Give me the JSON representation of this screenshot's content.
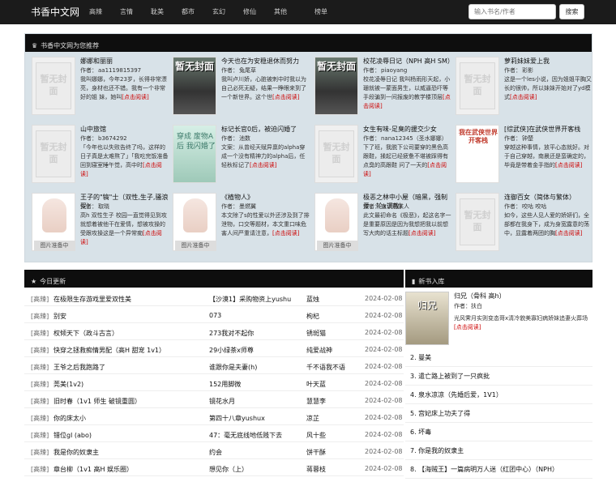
{
  "nav": {
    "brand": "书香中文网",
    "links": [
      "高辣",
      "言情",
      "耽美",
      "都市",
      "玄幻",
      "修仙",
      "其他"
    ],
    "rank": "榜单",
    "search_placeholder": "输入书名/作者",
    "search_button": "搜索"
  },
  "recommend": {
    "title": "书香中文网为您推荐",
    "read_link": "[点击阅读]",
    "placeholder_text": "暂无封面",
    "loading_text": "图片准备中",
    "items": [
      {
        "title": "娜娜和丽丽",
        "author": "aa1119815397",
        "desc": "我叫娜娜，今年23岁，长得非常漂亮，身材也还不错。我有一个非常好的姐 妹，她叫",
        "cover": "placeholder"
      },
      {
        "title": "今天也在为安稳退休而努力",
        "author": "兔尾草",
        "desc": "我叫卢川娇，心脏被刺中时我以为自己必死无疑，结果一睁眼来到了一个新世界。这个世",
        "cover": "dark",
        "cover_text": "暂无封面"
      },
      {
        "title": "校花凌辱日记（NPH 高H SM）",
        "author": "piaoyang",
        "desc": "校花凌辱日记 我叫杨雨形天起，小珊就被一蒙面男生，以威逼恐吓等手段骗到一间报废的教学楼顶层",
        "cover": "dark",
        "cover_text": "暂无封面"
      },
      {
        "title": "萝莉妹妹爱上我",
        "author": "彩影",
        "desc": "这是一个les小说，因为姐姐平胸又长的很帅，所以妹妹开始对了yd模式",
        "cover": "placeholder"
      },
      {
        "title": "山中旅馆",
        "author": "b3674292",
        "desc": "「今年也以失败告终了吗，这样的日子真是太难熬了」「我吃完饭准备回到寝室睡午觉，高中时",
        "cover": "placeholder"
      },
      {
        "title": "标记长官0后，被迫闪婚了",
        "author": "池数",
        "desc": "文案：从曾经天赋异禀的alpha穿成一个没有精神力的alpha后，任轻秋标记了",
        "cover": "mint",
        "cover_text": "穿成 废物A后 我闪婚了"
      },
      {
        "title": "女生有味-足臭的援交少女",
        "author": "nana12345（圣水娜娜）",
        "desc": "下了班，我脱下公司要穿的黑色高跟鞋，揉起已经疲惫不堪被踩得有点臭的高跟鞋 问了一天的",
        "cover": "placeholder"
      },
      {
        "title": "[综武侠]在武侠世界开客栈",
        "author": "钟楚",
        "desc": "穿越这种事情，放平心态就好。对于自己穿越，南晨还是蛮确定的，毕竟是带着金手指的",
        "cover": "red",
        "cover_text": "我在武侠世界开客栈"
      },
      {
        "title": "王子的\"犒\"士（双性,生子,骚浪受）",
        "author": "取晓",
        "desc": "高h 双性生子 校园一直觉得见到攻就想着被他干在爱情，想被攻操的受跟攻操这是一个异常痴",
        "cover": "loading"
      },
      {
        "title": "《植物人》",
        "author": "墨燃翼",
        "desc": "本文除了s的性爱以外还涉及到了排泄物，口交等题材，本文重口味危害人间严重请注意，",
        "cover": "loading"
      },
      {
        "title": "极恶之林中小屋（暗黑，强制爱，轮x调教）",
        "author": "血下燕某人",
        "desc": "此文最初命名《极恶》，起这名字一是重要原因是因为我想把我以前想写大肉的话主标题",
        "cover": "loading"
      },
      {
        "title": "连御百女（简体与繁体）",
        "author": "咬咕 咬咕",
        "desc": "如今，这些人见人爱的娇妍们，全部都在我身下，成为身宽露意的荡中，显露着两团的胸",
        "cover": "placeholder"
      }
    ]
  },
  "today": {
    "title": "今日更新",
    "rows": [
      {
        "cat": "[高辣]",
        "book": "在极限生存游戏里爱双性美",
        "chapter": "【沙漠1】采购物资上yushu",
        "author": "蓝烛",
        "date": "2024-02-08"
      },
      {
        "cat": "[高辣]",
        "book": "别安",
        "chapter": "073",
        "author": "枸杞",
        "date": "2024-02-08"
      },
      {
        "cat": "[高辣]",
        "book": "权倾天下（政斗古言）",
        "chapter": "273我对不起你",
        "author": "锈斑猫",
        "date": "2024-02-08"
      },
      {
        "cat": "[高辣]",
        "book": "快穿之拯救痴情男配（高H 甜宠 1v1）",
        "chapter": "29小绿茶x师尊",
        "author": "纯爱战神",
        "date": "2024-02-08"
      },
      {
        "cat": "[高辣]",
        "book": "王爷之后我跑路了",
        "chapter": "谁跟你是夫妻(h)",
        "author": "千不语我不语",
        "date": "2024-02-08"
      },
      {
        "cat": "[高辣]",
        "book": "莞美(1v2)",
        "chapter": "152用脚微",
        "author": "叶天蓝",
        "date": "2024-02-08"
      },
      {
        "cat": "[高辣]",
        "book": "旧时春（1v1 师生 破镜重圆）",
        "chapter": "镜花水月",
        "author": "慧慧李",
        "date": "2024-02-08"
      },
      {
        "cat": "[高辣]",
        "book": "你的床太小",
        "chapter": "第四十八章yushux",
        "author": "凉芷",
        "date": "2024-02-08"
      },
      {
        "cat": "[高辣]",
        "book": "错位gl (abo)",
        "chapter": "47：毫无底线地低贱下去",
        "author": "风十些",
        "date": "2024-02-08"
      },
      {
        "cat": "[高辣]",
        "book": "我是你的奴隶主",
        "chapter": "约会",
        "author": "饼干酥",
        "date": "2024-02-08"
      },
      {
        "cat": "[高辣]",
        "book": "章台柳（1v1 高H 娱乐圈）",
        "chapter": "想见你（上）",
        "author": "蒋蓉枝",
        "date": "2024-02-08"
      }
    ]
  },
  "newbooks": {
    "title": "新书入库",
    "feature": {
      "title": "归兄（骨科 高h）",
      "author": "扶白",
      "desc": "光风霁月实则变态哥x清冷貌美寡妇病娇妹追妻火葬场",
      "read_link": "[点击阅读]",
      "cover_text": "归兄"
    },
    "items": [
      "2. 曼美",
      "3. 遣亡路上被到了一只疯批",
      "4. 泉水凉凉（先婚后爱，1V1）",
      "5. 宫妃床上功夫了得",
      "6. 坏毒",
      "7. 你是我的奴隶主",
      "8. 【海贼王】一篇病明万人迷（红团中心）（NPH）"
    ]
  }
}
